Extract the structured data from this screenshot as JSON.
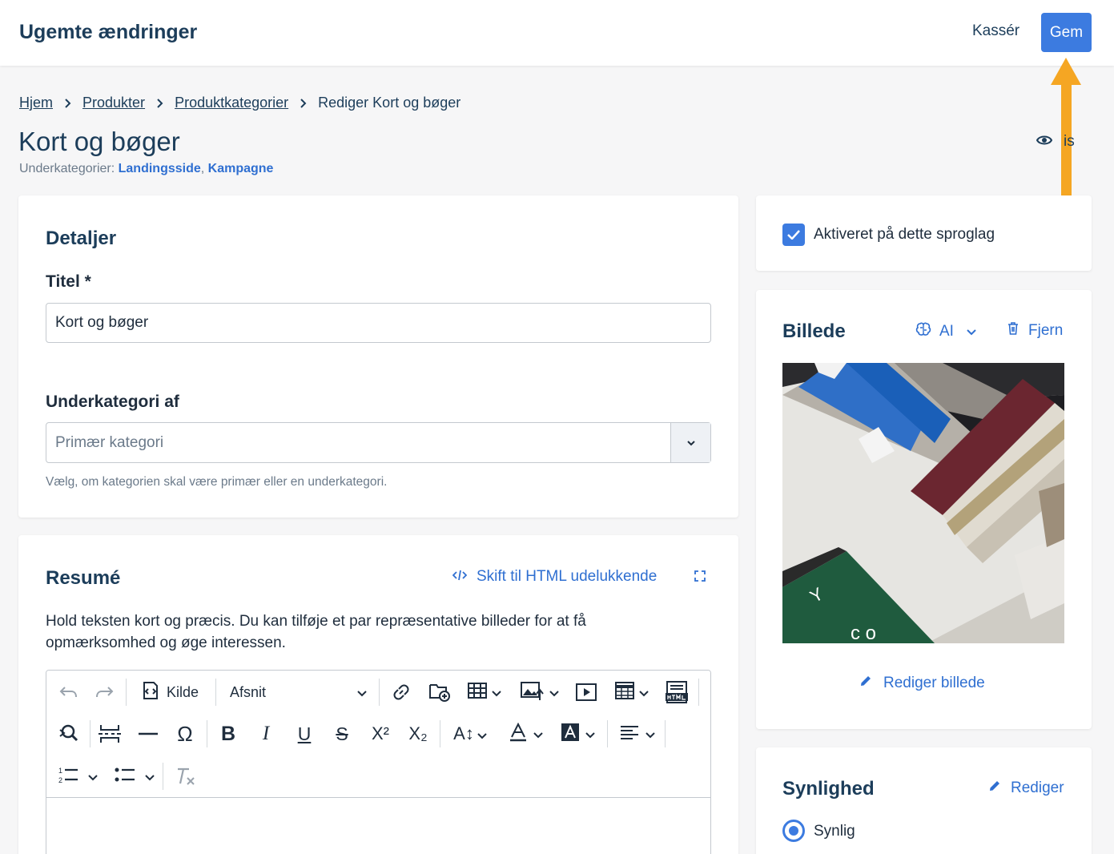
{
  "topbar": {
    "title": "Ugemte ændringer",
    "discard_label": "Kassér",
    "save_label": "Gem"
  },
  "breadcrumb": {
    "items": [
      "Hjem",
      "Produkter",
      "Produktkategorier"
    ],
    "current": "Rediger Kort og bøger"
  },
  "page": {
    "title": "Kort og bøger",
    "subcategories_label": "Underkategorier:",
    "subcategories": [
      "Landingsside",
      "Kampagne"
    ],
    "subcategory_separator": ",",
    "view_label": "is"
  },
  "details": {
    "heading": "Detaljer",
    "title_label": "Titel *",
    "title_value": "Kort og bøger",
    "parent_label": "Underkategori af",
    "parent_placeholder": "Primær kategori",
    "parent_help": "Vælg, om kategorien skal være primær eller en underkategori."
  },
  "summary": {
    "heading": "Resumé",
    "html_toggle_label": "Skift til HTML udelukkende",
    "description": "Hold teksten kort og præcis. Du kan tilføje et par repræsentative billeder for at få opmærksomhed og øge interessen.",
    "toolbar": {
      "source_label": "Kilde",
      "paragraph_label": "Afsnit"
    }
  },
  "language": {
    "enabled_label": "Aktiveret på dette sproglag",
    "enabled": true
  },
  "image": {
    "heading": "Billede",
    "ai_label": "AI",
    "remove_label": "Fjern",
    "edit_label": "Rediger billede"
  },
  "visibility": {
    "heading": "Synlighed",
    "edit_label": "Rediger",
    "option_label": "Synlig",
    "selected": true
  },
  "colors": {
    "primary": "#3c7be0",
    "link": "#2f6fd1",
    "heading": "#1c3d5a",
    "annotation_arrow": "#f5a623"
  }
}
